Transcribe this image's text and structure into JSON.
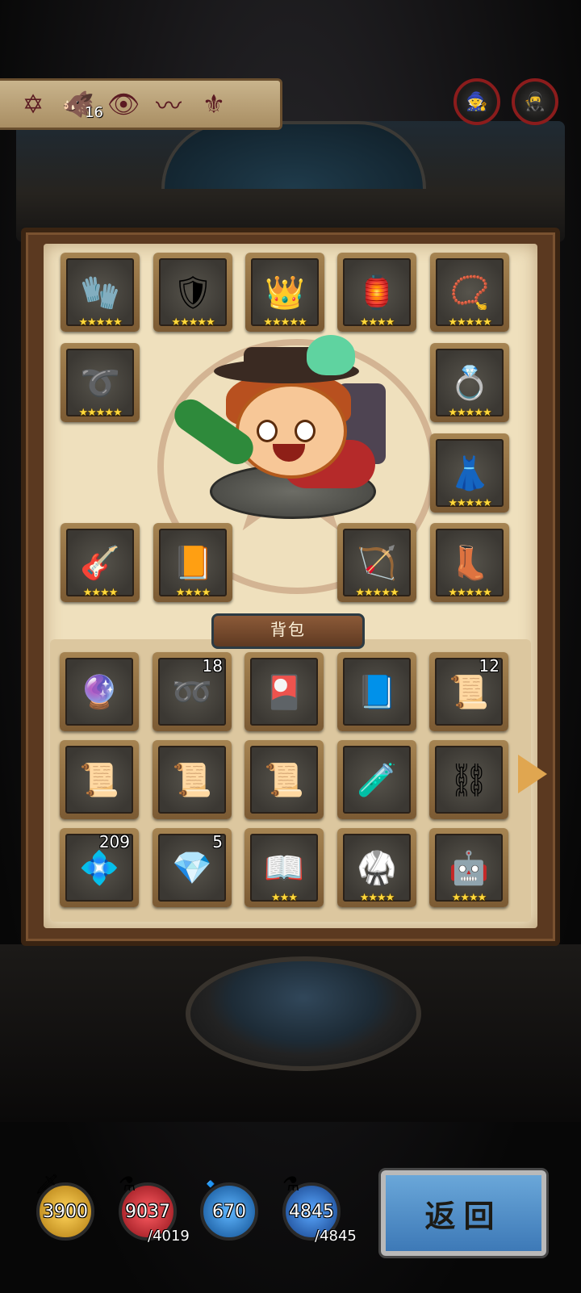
{
  "tribes": [
    {
      "icon": "hexagram-icon",
      "glyph": "✡",
      "count": ""
    },
    {
      "icon": "red-beast-icon",
      "glyph": "🐗",
      "count": "16"
    },
    {
      "icon": "purple-eye-icon",
      "glyph": "👁",
      "count": ""
    },
    {
      "icon": "soundwave-icon",
      "glyph": "〰",
      "count": ""
    },
    {
      "icon": "red-wing-icon",
      "glyph": "⚜",
      "count": ""
    }
  ],
  "corner_buttons": [
    {
      "icon": "hero-portrait-icon",
      "glyph": "🧙"
    },
    {
      "icon": "dark-hero-portrait-icon",
      "glyph": "🥷"
    }
  ],
  "equipment": [
    {
      "name": "glove",
      "glyph": "🧤",
      "stars": "★★★★★"
    },
    {
      "name": "chainmail-armor",
      "glyph": "🛡",
      "stars": "★★★★★"
    },
    {
      "name": "gold-crown",
      "glyph": "👑",
      "stars": "★★★★★"
    },
    {
      "name": "purple-lantern",
      "glyph": "🏮",
      "stars": "★★★★"
    },
    {
      "name": "ruby-necklace",
      "glyph": "📿",
      "stars": "★★★★★"
    },
    {
      "name": "leather-belt",
      "glyph": "➰",
      "stars": "★★★★★"
    },
    {
      "name": "emerald-ring",
      "glyph": "💍",
      "stars": "★★★★★"
    },
    {
      "name": "gold-skirt",
      "glyph": "👗",
      "stars": "★★★★★"
    },
    {
      "name": "lute",
      "glyph": "🎸",
      "stars": "★★★★"
    },
    {
      "name": "gold-tome",
      "glyph": "📙",
      "stars": "★★★★"
    },
    {
      "name": "golden-bow",
      "glyph": "🏹",
      "stars": "★★★★★"
    },
    {
      "name": "leather-boots",
      "glyph": "👢",
      "stars": "★★★★★"
    }
  ],
  "bag_title": "背包",
  "bag_items": [
    {
      "name": "purple-disc",
      "glyph": "🔮",
      "qty": "",
      "stars": ""
    },
    {
      "name": "purple-rope",
      "glyph": "➿",
      "qty": "18",
      "stars": ""
    },
    {
      "name": "gold-card",
      "glyph": "🎴",
      "qty": "",
      "stars": ""
    },
    {
      "name": "spell-book",
      "glyph": "📘",
      "qty": "",
      "stars": ""
    },
    {
      "name": "parchment-card",
      "glyph": "📜",
      "qty": "12",
      "stars": ""
    },
    {
      "name": "scroll-1",
      "glyph": "📜",
      "qty": "",
      "stars": ""
    },
    {
      "name": "scroll-2",
      "glyph": "📜",
      "qty": "",
      "stars": ""
    },
    {
      "name": "scroll-3",
      "glyph": "📜",
      "qty": "",
      "stars": ""
    },
    {
      "name": "potion-vial",
      "glyph": "🧪",
      "qty": "",
      "stars": ""
    },
    {
      "name": "silver-rings",
      "glyph": "⛓",
      "qty": "",
      "stars": ""
    },
    {
      "name": "blue-dust",
      "glyph": "💠",
      "qty": "209",
      "stars": ""
    },
    {
      "name": "blue-crystal",
      "glyph": "💎",
      "qty": "5",
      "stars": ""
    },
    {
      "name": "open-book",
      "glyph": "📖",
      "qty": "",
      "stars": "★★★"
    },
    {
      "name": "gold-armor",
      "glyph": "🥋",
      "qty": "",
      "stars": "★★★★"
    },
    {
      "name": "robot-figure",
      "glyph": "🤖",
      "qty": "",
      "stars": "★★★★"
    }
  ],
  "resources": [
    {
      "name": "gold",
      "icon": "gold-coin-icon",
      "value": "3900",
      "max": "",
      "color": "#d9a227"
    },
    {
      "name": "health-potion",
      "icon": "red-potion-icon",
      "value": "9037",
      "max": "/4019",
      "color": "#c9242f"
    },
    {
      "name": "diamond",
      "icon": "blue-orb-icon",
      "value": "670",
      "max": "",
      "color": "#1f78c8"
    },
    {
      "name": "mana-potion",
      "icon": "blue-potion-icon",
      "value": "4845",
      "max": "/4845",
      "color": "#2a6bc0"
    }
  ],
  "back_label": "返回"
}
